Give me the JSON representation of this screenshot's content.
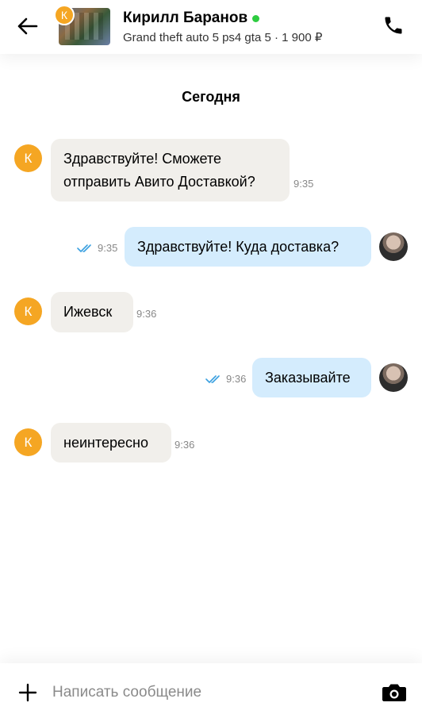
{
  "header": {
    "contact_name": "Кирилл Баранов",
    "listing": "Grand theft auto 5 ps4 gta 5  · 1 900 ₽",
    "avatar_letter": "К",
    "online_color": "#2ecc40",
    "icons": {
      "back": "arrow-left-icon",
      "call": "phone-icon"
    }
  },
  "chat": {
    "date_label": "Сегодня",
    "messages": [
      {
        "direction": "in",
        "avatar_letter": "К",
        "lines": [
          "Здравствуйте! Сможете",
          "отправить Авито Доставкой?"
        ],
        "time": "9:35"
      },
      {
        "direction": "out",
        "text": "Здравствуйте! Куда доставка?",
        "time": "9:35",
        "status": "read"
      },
      {
        "direction": "in",
        "avatar_letter": "К",
        "text": "Ижевск",
        "time": "9:36"
      },
      {
        "direction": "out",
        "text": "Заказывайте",
        "time": "9:36",
        "status": "read"
      },
      {
        "direction": "in",
        "avatar_letter": "К",
        "text": "неинтересно",
        "time": "9:36"
      }
    ]
  },
  "composer": {
    "placeholder": "Написать сообщение",
    "value": "",
    "icons": {
      "add": "plus-icon",
      "camera": "camera-icon"
    }
  },
  "colors": {
    "incoming_bubble": "#f1efeb",
    "outgoing_bubble": "#d4ecfd",
    "avatar_orange": "#f5a623",
    "read_checks": "#3aa0e0"
  }
}
